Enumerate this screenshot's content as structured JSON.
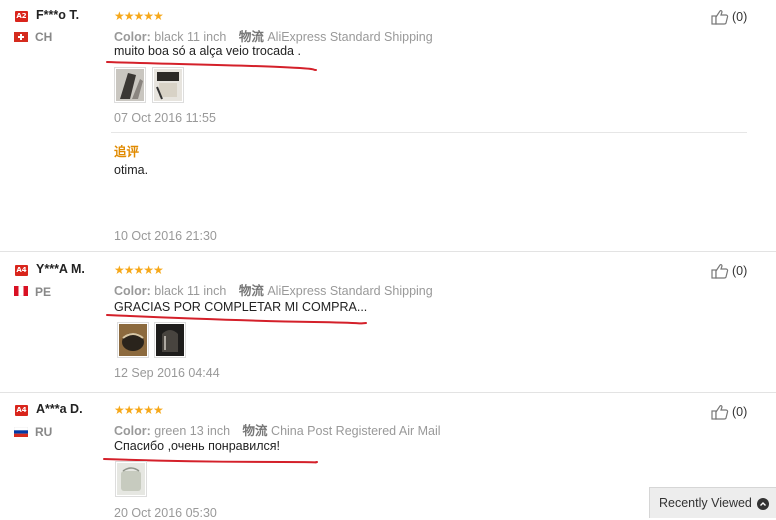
{
  "reviews": [
    {
      "level": "A2",
      "user": "F***o T.",
      "country": "CH",
      "color_key": "Color:",
      "color_val": "black 11 inch",
      "ship_key": "物流",
      "ship_val": "AliExpress Standard Shipping",
      "text": "muito boa só a alça veio trocada .",
      "date": "07 Oct 2016 11:55",
      "helpful": "(0)",
      "followup_label": "追评",
      "followup_text": "otima.",
      "followup_date": "10 Oct 2016 21:30"
    },
    {
      "level": "A4",
      "user": "Y***A M.",
      "country": "PE",
      "color_key": "Color:",
      "color_val": "black 11 inch",
      "ship_key": "物流",
      "ship_val": "AliExpress Standard Shipping",
      "text": "GRACIAS POR COMPLETAR MI COMPRA...",
      "date": "12 Sep 2016 04:44",
      "helpful": "(0)"
    },
    {
      "level": "A4",
      "user": "A***a D.",
      "country": "RU",
      "color_key": "Color:",
      "color_val": "green 13 inch",
      "ship_key": "物流",
      "ship_val": "China Post Registered Air Mail",
      "text": "Спасибо ,очень понравился!",
      "date": "20 Oct 2016 05:30",
      "helpful": "(0)"
    }
  ],
  "rating_stars": "★★★★★",
  "recently_viewed": "Recently Viewed",
  "colors": {
    "star": "#f6a81a",
    "badge": "#d9251c",
    "underline": "#d4202a",
    "append": "#e08a00"
  },
  "icons": [
    "thumbs-up-icon",
    "chevron-up-icon",
    "flag-icon"
  ]
}
